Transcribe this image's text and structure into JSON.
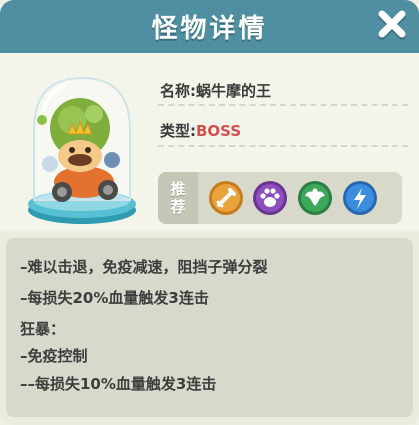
{
  "header": {
    "title": "怪物详情"
  },
  "monster": {
    "name_line": "名称:蜗牛摩的王",
    "type_prefix": "类型:",
    "type_value": "BOSS"
  },
  "recommend": {
    "label_top": "推",
    "label_bottom": "荐",
    "icons": [
      "sword-icon",
      "paw-icon",
      "wings-icon",
      "lightning-icon"
    ],
    "colors": [
      "#e8a43a",
      "#8f4ec0",
      "#3ea85a",
      "#3b8de0"
    ]
  },
  "description": {
    "lines": [
      "–难以击退，免疫减速，阻挡子弹分裂",
      "–每损失20%血量触发3连击",
      "狂暴：",
      "–免疫控制",
      "––每损失10%血量触发3连击"
    ]
  },
  "colors": {
    "header": "#4f8fa1",
    "boss_text": "#d24f4f"
  }
}
